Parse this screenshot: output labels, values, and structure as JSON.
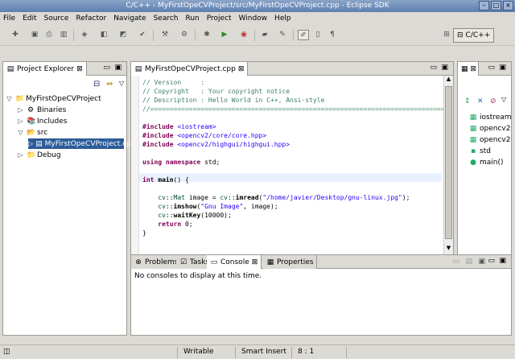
{
  "window": {
    "title": "C/C++ - MyFirstOpeCVProject/src/MyFirstOpeCVProject.cpp - Eclipse SDK"
  },
  "menu": [
    "File",
    "Edit",
    "Source",
    "Refactor",
    "Navigate",
    "Search",
    "Run",
    "Project",
    "Window",
    "Help"
  ],
  "perspective": {
    "label": "C/C++"
  },
  "project_explorer": {
    "tab": "Project Explorer",
    "items": [
      {
        "label": "MyFirstOpeCVProject",
        "depth": 0,
        "twisty": "▽",
        "icon": "📁",
        "selected": false
      },
      {
        "label": "Binaries",
        "depth": 1,
        "twisty": "▷",
        "icon": "⚙",
        "selected": false
      },
      {
        "label": "Includes",
        "depth": 1,
        "twisty": "▷",
        "icon": "📚",
        "selected": false
      },
      {
        "label": "src",
        "depth": 1,
        "twisty": "▽",
        "icon": "📂",
        "selected": false
      },
      {
        "label": "MyFirstOpeCVProject.cpp",
        "depth": 2,
        "twisty": "▷",
        "icon": "▤",
        "selected": true
      },
      {
        "label": "Debug",
        "depth": 1,
        "twisty": "▷",
        "icon": "📁",
        "selected": false
      }
    ]
  },
  "editor": {
    "tab": "MyFirstOpeCVProject.cpp",
    "lines": [
      [
        [
          "c-com",
          "// Version     :"
        ]
      ],
      [
        [
          "c-com",
          "// Copyright   : Your copyright notice"
        ]
      ],
      [
        [
          "c-com",
          "// Description : Hello World in C++, Ansi-style"
        ]
      ],
      [
        [
          "c-com",
          "//============================================================================"
        ]
      ],
      [
        [
          "",
          ""
        ]
      ],
      [
        [
          "c-dir",
          "#include "
        ],
        [
          "c-inc",
          "<iostream>"
        ]
      ],
      [
        [
          "c-dir",
          "#include "
        ],
        [
          "c-inc",
          "<opencv2/core/core.hpp>"
        ]
      ],
      [
        [
          "c-dir",
          "#include "
        ],
        [
          "c-inc",
          "<opencv2/highgui/highgui.hpp>"
        ]
      ],
      [
        [
          "",
          ""
        ]
      ],
      [
        [
          "c-kw",
          "using namespace"
        ],
        [
          "",
          " std;"
        ]
      ],
      [
        [
          "",
          ""
        ]
      ],
      [
        [
          "c-kw",
          "int"
        ],
        [
          "c-fn",
          " main"
        ],
        [
          "",
          "() {"
        ]
      ],
      [
        [
          "",
          ""
        ]
      ],
      [
        [
          "",
          "    "
        ],
        [
          "c-ns",
          "cv"
        ],
        [
          "",
          "::"
        ],
        [
          "c-ns",
          "Mat"
        ],
        [
          "",
          " image = "
        ],
        [
          "c-ns",
          "cv"
        ],
        [
          "",
          "::"
        ],
        [
          "c-fn",
          "imread"
        ],
        [
          "",
          "("
        ],
        [
          "c-str",
          "\"/home/javier/Desktop/gnu-linux.jpg\""
        ],
        [
          "",
          ");"
        ]
      ],
      [
        [
          "",
          "    "
        ],
        [
          "c-ns",
          "cv"
        ],
        [
          "",
          "::"
        ],
        [
          "c-fn",
          "imshow"
        ],
        [
          "",
          "("
        ],
        [
          "c-str",
          "\"Gnu Image\""
        ],
        [
          "",
          ", image);"
        ]
      ],
      [
        [
          "",
          "    "
        ],
        [
          "c-ns",
          "cv"
        ],
        [
          "",
          "::"
        ],
        [
          "c-fn",
          "waitKey"
        ],
        [
          "",
          "(10000);"
        ]
      ],
      [
        [
          "",
          "    "
        ],
        [
          "c-kw",
          "return"
        ],
        [
          "",
          " 0;"
        ]
      ],
      [
        [
          "",
          "}"
        ]
      ]
    ]
  },
  "outline": {
    "items": [
      {
        "label": "iostream",
        "icon": "▦"
      },
      {
        "label": "opencv2",
        "icon": "▦"
      },
      {
        "label": "opencv2",
        "icon": "▦"
      },
      {
        "label": "std",
        "icon": "▪"
      },
      {
        "label": "main()",
        "icon": "●"
      }
    ]
  },
  "bottom": {
    "tabs": [
      "Problems",
      "Tasks",
      "Console",
      "Properties"
    ],
    "active_tab": "Console",
    "message": "No consoles to display at this time."
  },
  "status": {
    "writable": "Writable",
    "insert_mode": "Smart Insert",
    "position": "8 : 1"
  },
  "colors": {
    "selection": "#2c5c99",
    "current_line": "#e8f2fe"
  }
}
